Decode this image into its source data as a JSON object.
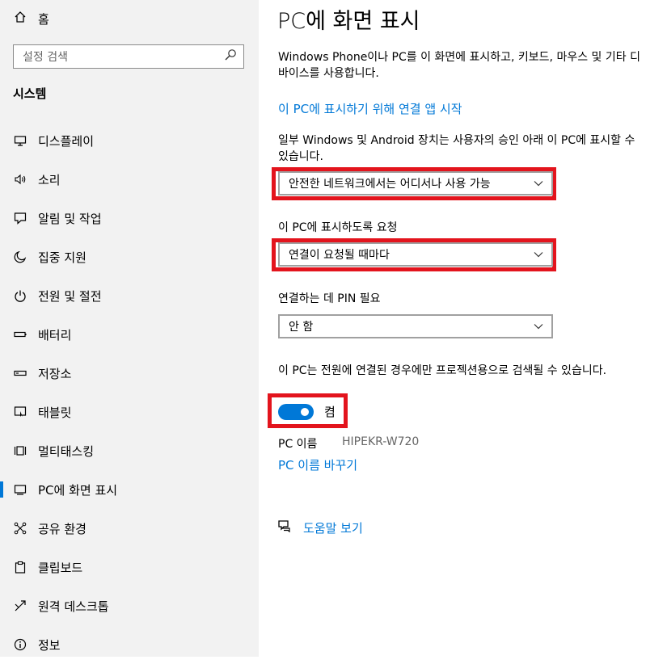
{
  "sidebar": {
    "home_label": "홈",
    "search_placeholder": "설정 검색",
    "section_title": "시스템",
    "items": [
      {
        "label": "디스플레이",
        "icon": "monitor-icon"
      },
      {
        "label": "소리",
        "icon": "speaker-icon"
      },
      {
        "label": "알림 및 작업",
        "icon": "notification-icon"
      },
      {
        "label": "집중 지원",
        "icon": "moon-icon"
      },
      {
        "label": "전원 및 절전",
        "icon": "power-icon"
      },
      {
        "label": "배터리",
        "icon": "battery-icon"
      },
      {
        "label": "저장소",
        "icon": "storage-icon"
      },
      {
        "label": "태블릿",
        "icon": "tablet-icon"
      },
      {
        "label": "멀티태스킹",
        "icon": "multitasking-icon"
      },
      {
        "label": "PC에 화면 표시",
        "icon": "project-icon",
        "active": true
      },
      {
        "label": "공유 환경",
        "icon": "shared-experiences-icon"
      },
      {
        "label": "클립보드",
        "icon": "clipboard-icon"
      },
      {
        "label": "원격 데스크톱",
        "icon": "remote-desktop-icon"
      },
      {
        "label": "정보",
        "icon": "info-icon"
      }
    ]
  },
  "main": {
    "title": "PC에 화면 표시",
    "description": "Windows Phone이나 PC를 이 화면에 표시하고, 키보드, 마우스 및 기타 디바이스를 사용합니다.",
    "launch_link": "이 PC에 표시하기 위해 연결 앱 시작",
    "availability_text": "일부 Windows 및 Android 장치는 사용자의 승인 아래 이 PC에 표시할 수 있습니다.",
    "availability_value": "안전한 네트워크에서는 어디서나 사용 가능",
    "ask_label": "이 PC에 표시하도록 요청",
    "ask_value": "연결이 요청될 때마다",
    "pin_label": "연결하는 데 PIN 필요",
    "pin_value": "안 함",
    "power_text": "이 PC는 전원에 연결된 경우에만 프로젝션용으로 검색될 수 있습니다.",
    "toggle_state": "켬",
    "pc_name_label": "PC 이름",
    "pc_name_value": "HIPEKR-W720",
    "rename_link": "PC 이름 바꾸기",
    "help_link": "도움말 보기"
  },
  "colors": {
    "accent": "#0078d7",
    "highlight": "#e3141d",
    "sidebar_bg": "#f2f2f2"
  }
}
